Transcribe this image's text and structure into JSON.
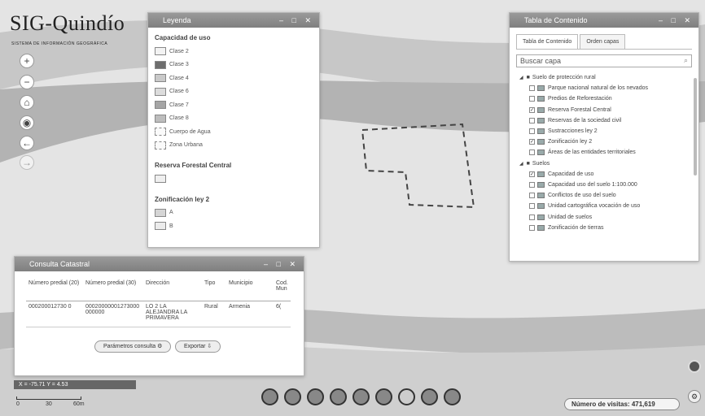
{
  "logo": {
    "title": "SIG-Quindío",
    "subtitle": "SISTEMA DE INFORMACIÓN GEOGRÁFICA"
  },
  "zoom_controls": [
    "+",
    "−",
    "⌂",
    "◉",
    "←",
    "→"
  ],
  "legend": {
    "title": "Leyenda",
    "sections": [
      {
        "heading": "Capacidad de uso",
        "items": [
          "Clase 2",
          "Clase 3",
          "Clase 4",
          "Clase 6",
          "Clase 7",
          "Clase 8",
          "Cuerpo de Agua",
          "Zona Urbana"
        ]
      },
      {
        "heading": "Reserva Forestal Central",
        "items": [
          ""
        ]
      },
      {
        "heading": "Zonificación ley 2",
        "items": [
          "A",
          "B"
        ]
      }
    ]
  },
  "toc": {
    "title": "Tabla de Contenido",
    "tabs": [
      "Tabla de Contenido",
      "Orden capas"
    ],
    "search_placeholder": "Buscar capa",
    "rows": [
      {
        "label": "Suelo de protección rural",
        "level": 0,
        "group": true,
        "checked": false
      },
      {
        "label": "Parque nacional natural de los nevados",
        "level": 1,
        "group": false,
        "checked": false
      },
      {
        "label": "Predios de Reforestación",
        "level": 1,
        "group": false,
        "checked": false
      },
      {
        "label": "Reserva Forestal Central",
        "level": 1,
        "group": false,
        "checked": true
      },
      {
        "label": "Reservas de la sociedad civil",
        "level": 1,
        "group": false,
        "checked": false
      },
      {
        "label": "Sustracciones ley 2",
        "level": 1,
        "group": false,
        "checked": false
      },
      {
        "label": "Zonificación ley 2",
        "level": 1,
        "group": false,
        "checked": true
      },
      {
        "label": "Áreas de las entidades territoriales",
        "level": 1,
        "group": false,
        "checked": false
      },
      {
        "label": "Suelos",
        "level": 0,
        "group": true,
        "checked": false
      },
      {
        "label": "Capacidad de uso",
        "level": 1,
        "group": false,
        "checked": true
      },
      {
        "label": "Capacidad uso del suelo 1:100.000",
        "level": 1,
        "group": false,
        "checked": false
      },
      {
        "label": "Conflictos de uso del suelo",
        "level": 1,
        "group": false,
        "checked": false
      },
      {
        "label": "Unidad cartográfica vocación de uso",
        "level": 1,
        "group": false,
        "checked": false
      },
      {
        "label": "Unidad de suelos",
        "level": 1,
        "group": false,
        "checked": false
      },
      {
        "label": "Zonificación de tierras",
        "level": 1,
        "group": false,
        "checked": false
      }
    ]
  },
  "results": {
    "title": "Consulta Catastral",
    "columns": [
      "Número predial (20)",
      "Número predial (30)",
      "Dirección",
      "Tipo",
      "Municipio",
      "Cod. Mun"
    ],
    "row": [
      "000200012730 0",
      "00020000001273000000000",
      "LO 2 LA ALEJANDRA LA PRIMAVERA",
      "Rural",
      "Armenia",
      "6("
    ],
    "buttons": [
      "Parámetros consulta",
      "Exportar"
    ]
  },
  "coords": "X = -75.71  Y = 4.53",
  "scale": {
    "labels": [
      "0",
      "30",
      "60m"
    ]
  },
  "visits": {
    "label": "Número de visitas:",
    "value": "471,619"
  },
  "colors": {
    "header": "#8c8c8c",
    "map_bg": "#e6e6e6",
    "band_dark": "#b9b9b9"
  }
}
